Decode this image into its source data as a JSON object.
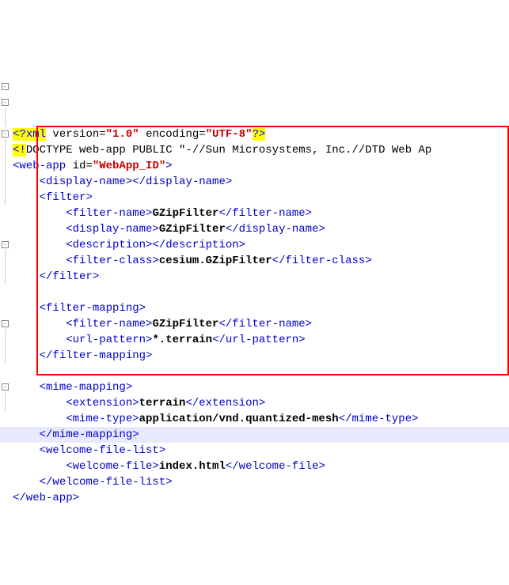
{
  "xml_decl": {
    "open": "<?",
    "name": "xml",
    "version_attr": " version=",
    "version_val": "\"1.0\"",
    "encoding_attr": " encoding=",
    "encoding_val": "\"UTF-8\"",
    "close": "?>"
  },
  "doctype": {
    "open": "<!",
    "text": "DOCTYPE web-app PUBLIC \"-//Sun Microsystems, Inc.//DTD Web Ap"
  },
  "webapp": {
    "open": "<web-app ",
    "id_attr": "id=",
    "id_val": "\"WebApp_ID\"",
    "close_gt": ">",
    "close_tag": "</web-app>"
  },
  "display_name": {
    "open": "<display-name>",
    "close": "</display-name>"
  },
  "filter": {
    "open": "<filter>",
    "close": "</filter>",
    "name_open": "<filter-name>",
    "name_val": "GZipFilter",
    "name_close": "</filter-name>",
    "disp_open": "<display-name>",
    "disp_val": "GZipFilter",
    "disp_close": "</display-name>",
    "desc_open": "<description>",
    "desc_close": "</description>",
    "class_open": "<filter-class>",
    "class_val": "cesium.GZipFilter",
    "class_close": "</filter-class>"
  },
  "filter_mapping": {
    "open": "<filter-mapping>",
    "close": "</filter-mapping>",
    "name_open": "<filter-name>",
    "name_val": "GZipFilter",
    "name_close": "</filter-name>",
    "url_open": "<url-pattern>",
    "url_val": "*.terrain",
    "url_close": "</url-pattern>"
  },
  "mime_mapping": {
    "open": "<mime-mapping>",
    "close": "</mime-mapping>",
    "ext_open": "<extension>",
    "ext_val": "terrain",
    "ext_close": "</extension>",
    "type_open": "<mime-type>",
    "type_val": "application/vnd.quantized-mesh",
    "type_close": "</mime-type>"
  },
  "welcome": {
    "open": "<welcome-file-list>",
    "close": "</welcome-file-list>",
    "file_open": "<welcome-file>",
    "file_val": "index.html",
    "file_close": "</welcome-file>"
  }
}
